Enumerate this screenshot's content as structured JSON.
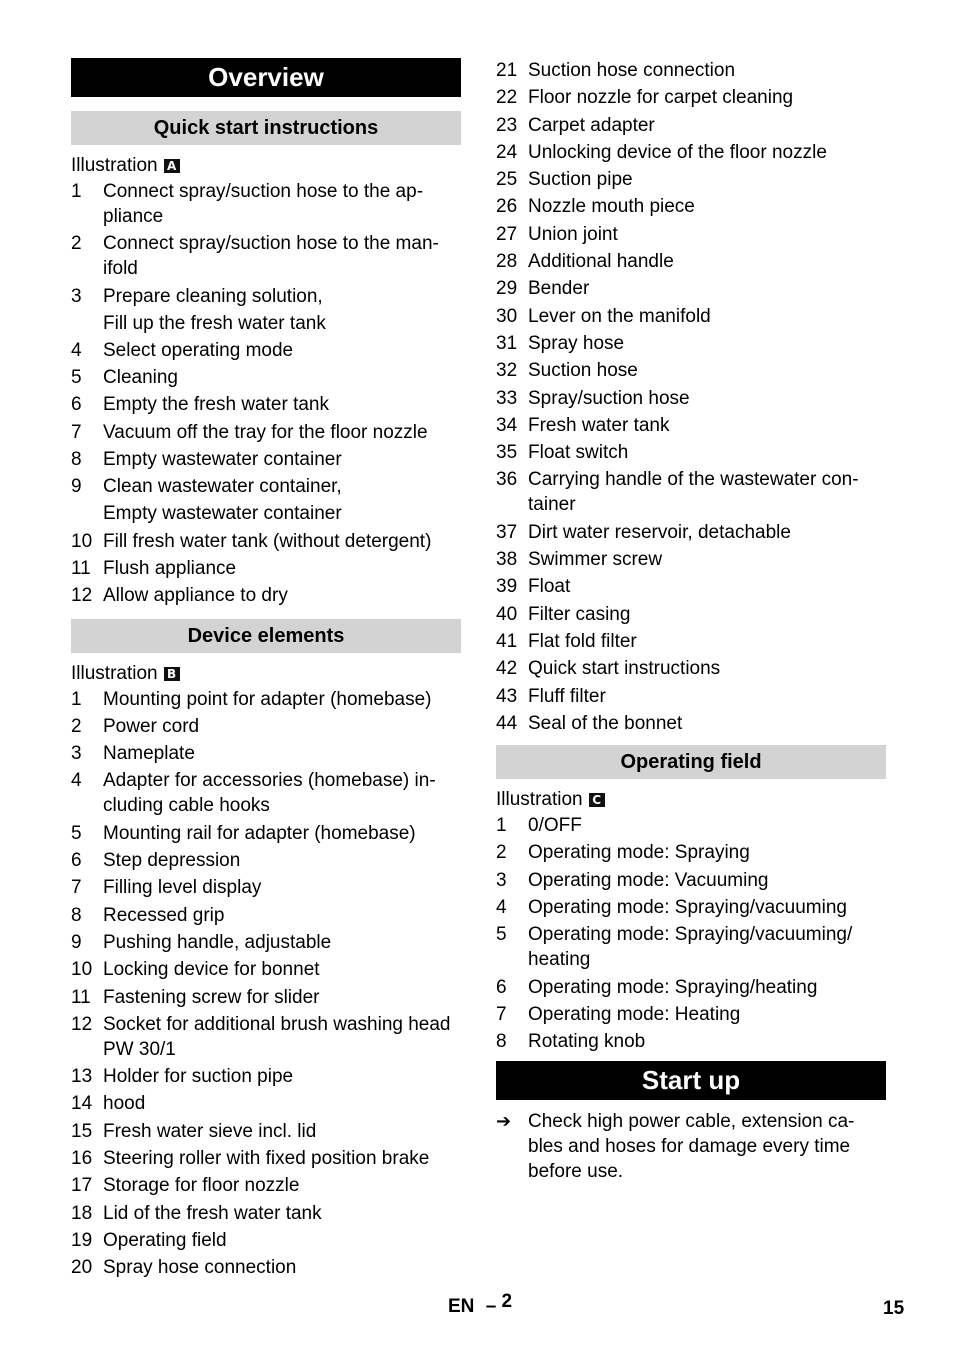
{
  "overview": {
    "title": "Overview",
    "quick_start": {
      "heading": "Quick start instructions",
      "illustration_label": "Illustration",
      "illustration_letter": "A",
      "items": [
        {
          "num": "1",
          "lines": [
            "Connect spray/suction hose to the ap-pliance"
          ]
        },
        {
          "num": "2",
          "lines": [
            "Connect spray/suction hose to the man-ifold"
          ]
        },
        {
          "num": "3",
          "lines": [
            "Prepare cleaning solution,",
            "Fill up the fresh water tank"
          ]
        },
        {
          "num": "4",
          "lines": [
            "Select operating mode"
          ]
        },
        {
          "num": "5",
          "lines": [
            "Cleaning"
          ]
        },
        {
          "num": "6",
          "lines": [
            "Empty the fresh water tank"
          ]
        },
        {
          "num": "7",
          "lines": [
            "Vacuum off the tray for the floor nozzle"
          ]
        },
        {
          "num": "8",
          "lines": [
            "Empty wastewater container"
          ]
        },
        {
          "num": "9",
          "lines": [
            "Clean wastewater container,",
            "Empty wastewater container"
          ]
        },
        {
          "num": "10",
          "lines": [
            "Fill fresh water tank (without detergent)"
          ]
        },
        {
          "num": "11",
          "lines": [
            "Flush appliance"
          ]
        },
        {
          "num": "12",
          "lines": [
            "Allow appliance to dry"
          ]
        }
      ]
    },
    "device_elements": {
      "heading": "Device elements",
      "illustration_label": "Illustration",
      "illustration_letter": "B",
      "items": [
        {
          "num": "1",
          "text": "Mounting point for adapter (homebase)"
        },
        {
          "num": "2",
          "text": "Power cord"
        },
        {
          "num": "3",
          "text": "Nameplate"
        },
        {
          "num": "4",
          "text": "Adapter for accessories (homebase) in-cluding cable hooks"
        },
        {
          "num": "5",
          "text": "Mounting rail for adapter (homebase)"
        },
        {
          "num": "6",
          "text": "Step depression"
        },
        {
          "num": "7",
          "text": "Filling level display"
        },
        {
          "num": "8",
          "text": "Recessed grip"
        },
        {
          "num": "9",
          "text": "Pushing handle, adjustable"
        },
        {
          "num": "10",
          "text": "Locking device for bonnet"
        },
        {
          "num": "11",
          "text": "Fastening screw for slider"
        },
        {
          "num": "12",
          "text": "Socket for additional brush washing head PW 30/1"
        },
        {
          "num": "13",
          "text": "Holder for suction pipe"
        },
        {
          "num": "14",
          "text": "hood"
        },
        {
          "num": "15",
          "text": "Fresh water sieve incl. lid"
        },
        {
          "num": "16",
          "text": "Steering roller with fixed position brake"
        },
        {
          "num": "17",
          "text": "Storage for floor nozzle"
        },
        {
          "num": "18",
          "text": "Lid of the fresh water tank"
        },
        {
          "num": "19",
          "text": "Operating field"
        },
        {
          "num": "20",
          "text": "Spray hose connection"
        },
        {
          "num": "21",
          "text": "Suction hose connection"
        },
        {
          "num": "22",
          "text": "Floor nozzle for carpet cleaning"
        },
        {
          "num": "23",
          "text": "Carpet adapter"
        },
        {
          "num": "24",
          "text": "Unlocking device of the floor nozzle"
        },
        {
          "num": "25",
          "text": "Suction pipe"
        },
        {
          "num": "26",
          "text": "Nozzle mouth piece"
        },
        {
          "num": "27",
          "text": "Union joint"
        },
        {
          "num": "28",
          "text": "Additional handle"
        },
        {
          "num": "29",
          "text": "Bender"
        },
        {
          "num": "30",
          "text": "Lever on the manifold"
        },
        {
          "num": "31",
          "text": "Spray hose"
        },
        {
          "num": "32",
          "text": "Suction hose"
        },
        {
          "num": "33",
          "text": "Spray/suction hose"
        },
        {
          "num": "34",
          "text": "Fresh water tank"
        },
        {
          "num": "35",
          "text": "Float switch"
        },
        {
          "num": "36",
          "text": "Carrying handle of the wastewater con-tainer"
        },
        {
          "num": "37",
          "text": "Dirt water reservoir, detachable"
        },
        {
          "num": "38",
          "text": "Swimmer screw"
        },
        {
          "num": "39",
          "text": "Float"
        },
        {
          "num": "40",
          "text": "Filter casing"
        },
        {
          "num": "41",
          "text": "Flat fold filter"
        },
        {
          "num": "42",
          "text": "Quick start instructions"
        },
        {
          "num": "43",
          "text": "Fluff filter"
        },
        {
          "num": "44",
          "text": "Seal of the bonnet"
        }
      ]
    },
    "operating_field": {
      "heading": "Operating field",
      "illustration_label": "Illustration",
      "illustration_letter": "C",
      "items": [
        {
          "num": "1",
          "text": "0/OFF"
        },
        {
          "num": "2",
          "text": "Operating mode: Spraying"
        },
        {
          "num": "3",
          "text": "Operating mode: Vacuuming"
        },
        {
          "num": "4",
          "text": "Operating mode: Spraying/vacuuming"
        },
        {
          "num": "5",
          "text": "Operating mode: Spraying/vacuuming/ heating"
        },
        {
          "num": "6",
          "text": "Operating mode: Spraying/heating"
        },
        {
          "num": "7",
          "text": "Operating mode: Heating"
        },
        {
          "num": "8",
          "text": "Rotating knob"
        }
      ]
    }
  },
  "start_up": {
    "title": "Start up",
    "bullet_icon": "arrow-right-icon",
    "bullet_glyph": "➔",
    "text": "Check high power cable, extension ca-bles and hoses for damage every time before use."
  },
  "footer": {
    "language": "EN",
    "dash": "–",
    "section_page": "2",
    "page_number": "15"
  }
}
